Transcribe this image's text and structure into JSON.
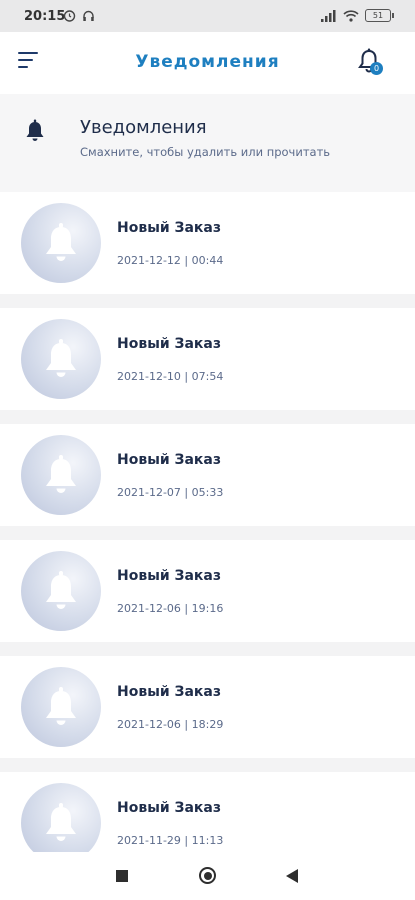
{
  "status_bar": {
    "time": "20:15",
    "battery": "51",
    "icons": [
      "alarm-icon",
      "headphones-icon",
      "signal-icon",
      "wifi-icon",
      "battery-icon"
    ]
  },
  "app_bar": {
    "title": "Уведомления",
    "badge_count": "0",
    "accent_color": "#1e7fc0"
  },
  "header": {
    "title": "Уведомления",
    "subtitle": "Смахните, чтобы удалить или прочитать"
  },
  "notifications": [
    {
      "title": "Новый Заказ",
      "date": "2021-12-12 | 00:44"
    },
    {
      "title": "Новый Заказ",
      "date": "2021-12-10 | 07:54"
    },
    {
      "title": "Новый Заказ",
      "date": "2021-12-07 | 05:33"
    },
    {
      "title": "Новый Заказ",
      "date": "2021-12-06 | 19:16"
    },
    {
      "title": "Новый Заказ",
      "date": "2021-12-06 | 18:29"
    },
    {
      "title": "Новый Заказ",
      "date": "2021-11-29 | 11:13"
    }
  ],
  "nav_bar": {
    "icons": [
      "recents-icon",
      "home-icon",
      "back-icon"
    ]
  }
}
